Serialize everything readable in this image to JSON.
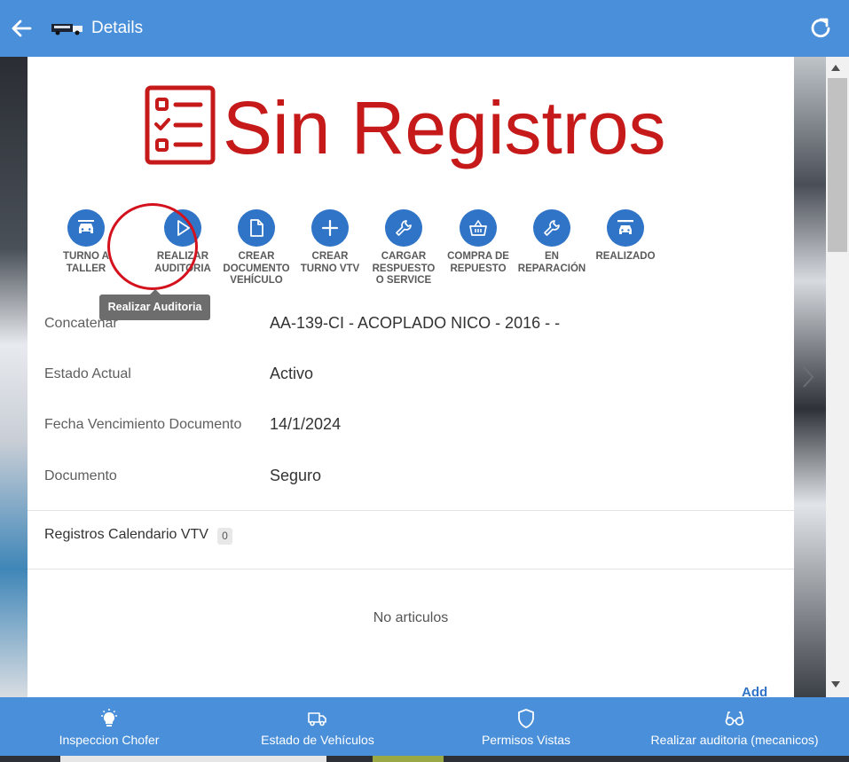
{
  "header": {
    "title": "Details",
    "back_icon": "arrow-left-icon",
    "brand_icon": "truck-icon",
    "refresh_icon": "refresh-icon"
  },
  "colors": {
    "brand_blue": "#4a8fd9",
    "action_blue": "#2f74c7",
    "banner_red": "#c61a1a",
    "ring_red": "#d4121e"
  },
  "banner": {
    "text": "Sin Registros",
    "icon": "checklist-icon"
  },
  "actions": [
    {
      "label": "TURNO A TALLER",
      "icon": "car-service-icon"
    },
    {
      "label": "REALIZAR AUDITORIA",
      "icon": "play-icon"
    },
    {
      "label": "CREAR DOCUMENTO VEHÍCULO",
      "icon": "document-icon"
    },
    {
      "label": "CREAR TURNO VTV",
      "icon": "plus-icon"
    },
    {
      "label": "CARGAR RESPUESTO O SERVICE",
      "icon": "wrench-icon"
    },
    {
      "label": "COMPRA DE REPUESTO",
      "icon": "basket-icon"
    },
    {
      "label": "EN REPARACIÓN",
      "icon": "wrench-icon"
    },
    {
      "label": "REALIZADO",
      "icon": "car-lift-icon"
    }
  ],
  "tooltip": "Realizar Auditoria",
  "fields": [
    {
      "label": "Concatenar",
      "value": "AA-139-CI - ACOPLADO NICO - 2016 -  -"
    },
    {
      "label": "Estado Actual",
      "value": "Activo"
    },
    {
      "label": "Fecha Vencimiento Documento",
      "value": "14/1/2024"
    },
    {
      "label": "Documento",
      "value": "Seguro"
    }
  ],
  "section": {
    "title": "Registros Calendario VTV",
    "count": "0",
    "empty_text": "No articulos",
    "add_label": "Add"
  },
  "bottom_nav": [
    {
      "label": "Inspeccion Chofer",
      "icon": "lightbulb-icon"
    },
    {
      "label": "Estado de Vehículos",
      "icon": "truck-icon"
    },
    {
      "label": "Permisos Vistas",
      "icon": "shield-icon"
    },
    {
      "label": "Realizar auditoria (mecanicos)",
      "icon": "glasses-icon"
    }
  ]
}
